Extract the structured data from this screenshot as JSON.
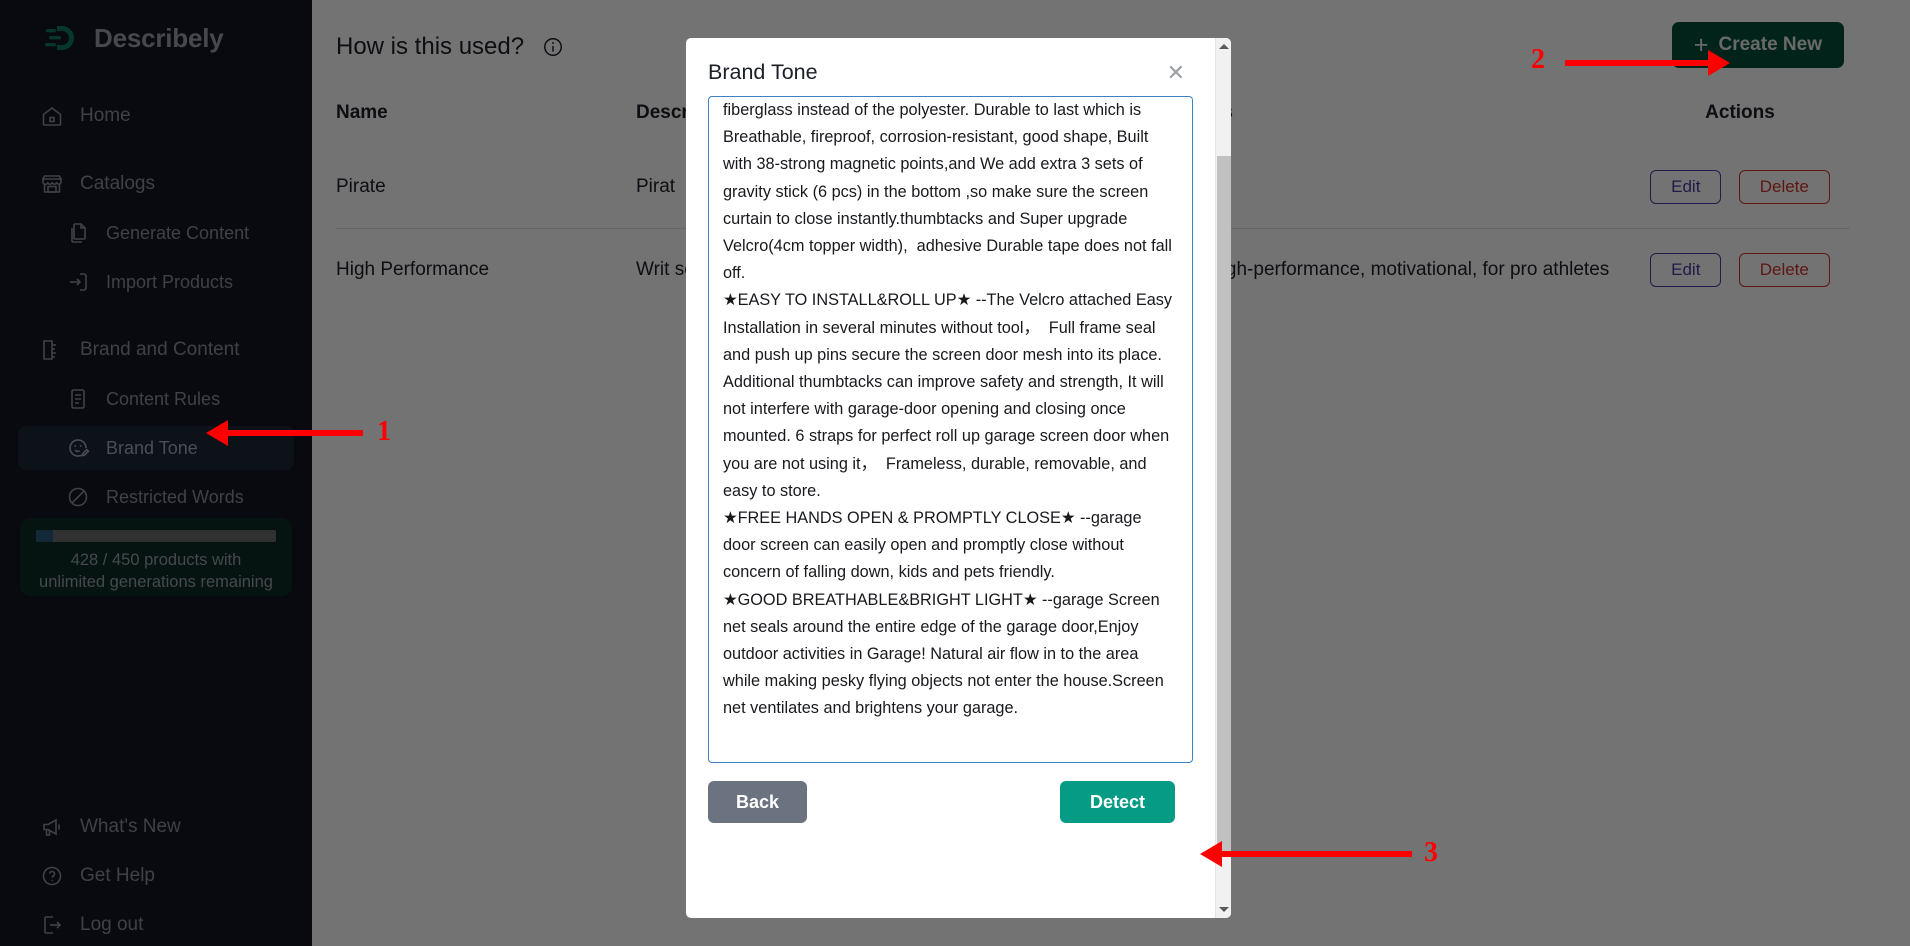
{
  "brand": {
    "name": "Describely",
    "logo_icon": "describely-logo-icon"
  },
  "sidebar": {
    "items": [
      {
        "label": "Home",
        "icon": "home-icon",
        "level": "top",
        "active": false
      },
      {
        "label": "Catalogs",
        "icon": "store-icon",
        "level": "top",
        "active": false
      },
      {
        "label": "Generate Content",
        "icon": "documents-icon",
        "level": "sub",
        "active": false
      },
      {
        "label": "Import Products",
        "icon": "import-arrow-icon",
        "level": "sub",
        "active": false
      },
      {
        "label": "Brand and Content",
        "icon": "ruler-icon",
        "level": "top",
        "active": false
      },
      {
        "label": "Content Rules",
        "icon": "document-list-icon",
        "level": "sub",
        "active": false
      },
      {
        "label": "Brand Tone",
        "icon": "smiley-pencil-icon",
        "level": "sub",
        "active": true
      },
      {
        "label": "Restricted Words",
        "icon": "no-entry-icon",
        "level": "sub",
        "active": false
      }
    ],
    "bottom_items": [
      {
        "label": "What's New",
        "icon": "megaphone-icon"
      },
      {
        "label": "Get Help",
        "icon": "question-circle-icon"
      },
      {
        "label": "Log out",
        "icon": "logout-icon"
      }
    ],
    "usage": {
      "used": "428",
      "separator": "/",
      "total": "450",
      "text": "428 /  450  products with unlimited generations remaining",
      "progress_percent": 7,
      "bar_color": "#2b5a7e",
      "card_color": "#0c2a27"
    }
  },
  "page": {
    "heading": "How is this used?",
    "info_icon": "info-circle-icon",
    "create_new_label": "Create New",
    "create_new_icon": "plus-icon",
    "table": {
      "columns": [
        "Name",
        "Description",
        "Tags",
        "Actions"
      ],
      "rows": [
        {
          "name": "Pirate",
          "description": "Pirat",
          "tags": "",
          "edit_label": "Edit",
          "delete_label": "Delete"
        },
        {
          "name": "High Performance",
          "description": "Writ seek",
          "tags": "d, high-performance, motivational, for pro athletes",
          "edit_label": "Edit",
          "delete_label": "Delete"
        }
      ]
    }
  },
  "modal": {
    "title": "Brand Tone",
    "close_icon": "close-icon",
    "textarea_value": "fiberglass instead of the polyester. Durable to last which is Breathable, fireproof, corrosion-resistant, good shape, Built with 38-strong magnetic points,and We add extra 3 sets of gravity stick (6 pcs) in the bottom ,so make sure the screen curtain to close instantly.thumbtacks and Super upgrade Velcro(4cm topper width),  adhesive Durable tape does not fall off.\n★EASY TO INSTALL&ROLL UP★ --The Velcro attached Easy Installation in several minutes without tool，  Full frame seal and push up pins secure the screen door mesh into its place. Additional thumbtacks can improve safety and strength, It will not interfere with garage-door opening and closing once mounted. 6 straps for perfect roll up garage screen door when you are not using it，  Frameless, durable, removable, and easy to store.\n★FREE HANDS OPEN & PROMPTLY CLOSE★ --garage door screen can easily open and promptly close without concern of falling down, kids and pets friendly.\n★GOOD BREATHABLE&BRIGHT LIGHT★ --garage Screen net seals around the entire edge of the garage door,Enjoy outdoor activities in Garage! Natural air flow in to the area while making pesky flying objects not enter the house.Screen net ventilates and brightens your garage.",
    "back_label": "Back",
    "detect_label": "Detect",
    "accent_color": "#069b84"
  },
  "annotations": {
    "markers": [
      {
        "number": "1",
        "points_to": "sidebar-item-brand-tone"
      },
      {
        "number": "2",
        "points_to": "create-new-button"
      },
      {
        "number": "3",
        "points_to": "detect-button"
      }
    ],
    "color": "#ff0000"
  }
}
